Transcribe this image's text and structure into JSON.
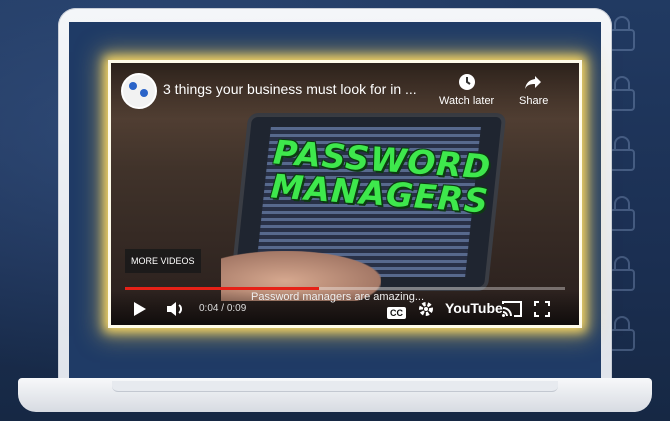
{
  "video": {
    "title": "3 things your business must look for in ...",
    "watch_later_label": "Watch later",
    "share_label": "Share",
    "overlay_text_line1": "PASSWORD",
    "overlay_text_line2": "MANAGERS",
    "more_videos_label": "MORE VIDEOS",
    "caption_text": "Password managers are amazing...",
    "time_current": "0:04",
    "time_separator": " / ",
    "time_total": "0:09",
    "progress": 0.44,
    "brand_label": "YouTube",
    "cc_label": "CC"
  },
  "colors": {
    "progress": "#e62117",
    "overlay_text": "#3ee84c",
    "glow": "#f5d565"
  },
  "icons": [
    "clock-icon",
    "share-icon",
    "play-icon",
    "volume-icon",
    "cc-icon",
    "gear-icon",
    "cast-icon",
    "fullscreen-icon"
  ]
}
